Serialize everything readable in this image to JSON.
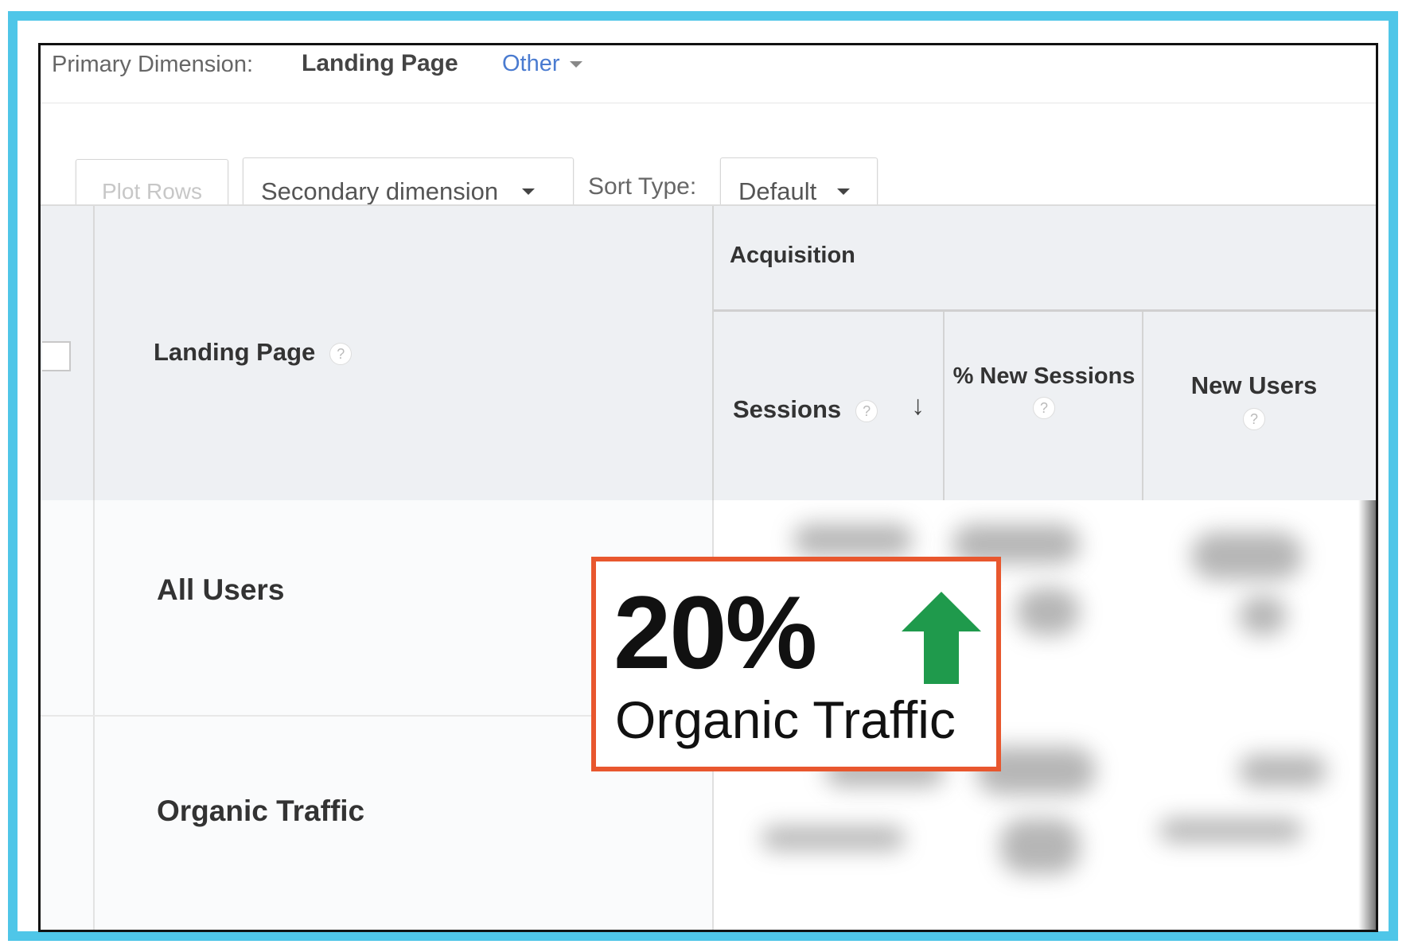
{
  "primary_dimension": {
    "label": "Primary Dimension:",
    "current": "Landing Page",
    "other": "Other"
  },
  "toolbar": {
    "plot_rows": "Plot Rows",
    "secondary_dimension": "Secondary dimension",
    "sort_type_label": "Sort Type:",
    "sort_type_value": "Default"
  },
  "table": {
    "landing_page_header": "Landing Page",
    "acquisition_header": "Acquisition",
    "columns": [
      "Sessions",
      "% New Sessions",
      "New Users"
    ],
    "help_glyph": "?",
    "sort_glyph": "↓",
    "rows": [
      "All Users",
      "Organic Traffic"
    ]
  },
  "callout": {
    "value": "20%",
    "label": "Organic Traffic",
    "arrow_color": "#1f9a4c",
    "border_color": "#e8572e"
  },
  "colors": {
    "frame": "#4fc6e8",
    "link": "#4a7bd0"
  }
}
